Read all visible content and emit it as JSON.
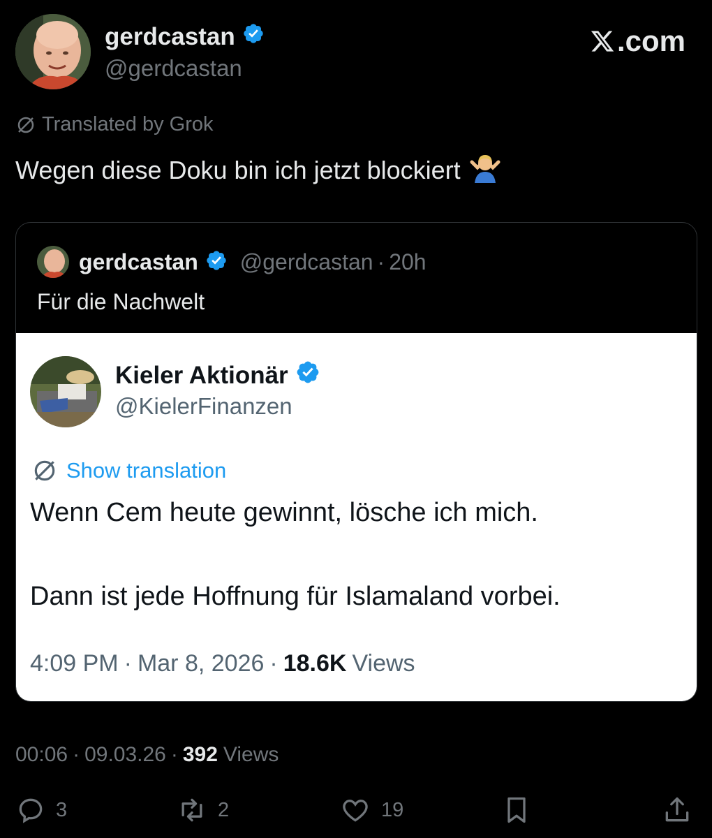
{
  "header": {
    "display_name": "gerdcastan",
    "handle": "@gerdcastan",
    "brand": ".com",
    "verified_icon": "verified-badge-icon"
  },
  "post": {
    "translated_label": "Translated by Grok",
    "text": "Wegen diese Doku bin ich jetzt blockiert",
    "emoji": "🤷‍♂️"
  },
  "quote": {
    "display_name": "gerdcastan",
    "handle": "@gerdcastan",
    "separator": "·",
    "age": "20h",
    "text": "Für die Nachwelt"
  },
  "embedded": {
    "display_name": "Kieler Aktionär",
    "handle": "@KielerFinanzen",
    "show_translation": "Show translation",
    "line1": "Wenn Cem heute gewinnt, lösche ich mich.",
    "line2": "Dann ist jede Hoffnung für Islamaland vorbei.",
    "time": "4:09 PM",
    "date": "Mar 8, 2026",
    "views_count": "18.6K",
    "views_label": "Views"
  },
  "meta": {
    "time": "00:06",
    "date": "09.03.26",
    "views_count": "392",
    "views_label": "Views"
  },
  "actions": {
    "replies": "3",
    "reposts": "2",
    "likes": "19"
  },
  "colors": {
    "background": "#000000",
    "text_primary": "#e7e9ea",
    "text_secondary": "#71767b",
    "verified_blue": "#1d9bf0",
    "embed_background": "#ffffff"
  }
}
